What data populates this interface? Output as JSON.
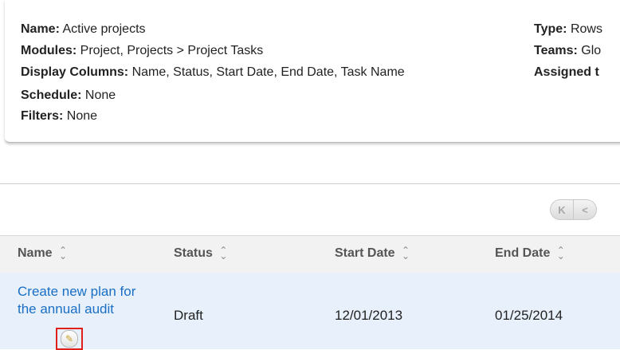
{
  "summary": {
    "name_label": "Name:",
    "name_value": "Active projects",
    "modules_label": "Modules:",
    "modules_value": "Project, Projects > Project Tasks",
    "display_columns_label": "Display Columns:",
    "display_columns_value": "Name, Status, Start Date, End Date, Task Name",
    "schedule_label": "Schedule:",
    "schedule_value": "None",
    "filters_label": "Filters:",
    "filters_value": "None",
    "type_label": "Type:",
    "type_value": "Rows",
    "teams_label": "Teams:",
    "teams_value": "Glo",
    "assigned_label": "Assigned t"
  },
  "pager": {
    "first_icon": "first-page-icon",
    "first_glyph": "K",
    "prev_icon": "previous-page-icon",
    "prev_glyph": "<"
  },
  "table": {
    "columns": [
      {
        "label": "Name"
      },
      {
        "label": "Status"
      },
      {
        "label": "Start Date"
      },
      {
        "label": "End Date"
      }
    ],
    "rows": [
      {
        "name": "Create new plan for the annual audit",
        "status": "Draft",
        "start_date": "12/01/2013",
        "end_date": "01/25/2014"
      }
    ],
    "edit_icon": "pencil-icon",
    "edit_glyph": "✎",
    "sort_up_glyph": "⌃",
    "sort_down_glyph": "⌄"
  },
  "colors": {
    "link": "#1a6fc4",
    "row_highlight": "#e7f0fb",
    "edit_highlight_border": "#e0201a"
  }
}
